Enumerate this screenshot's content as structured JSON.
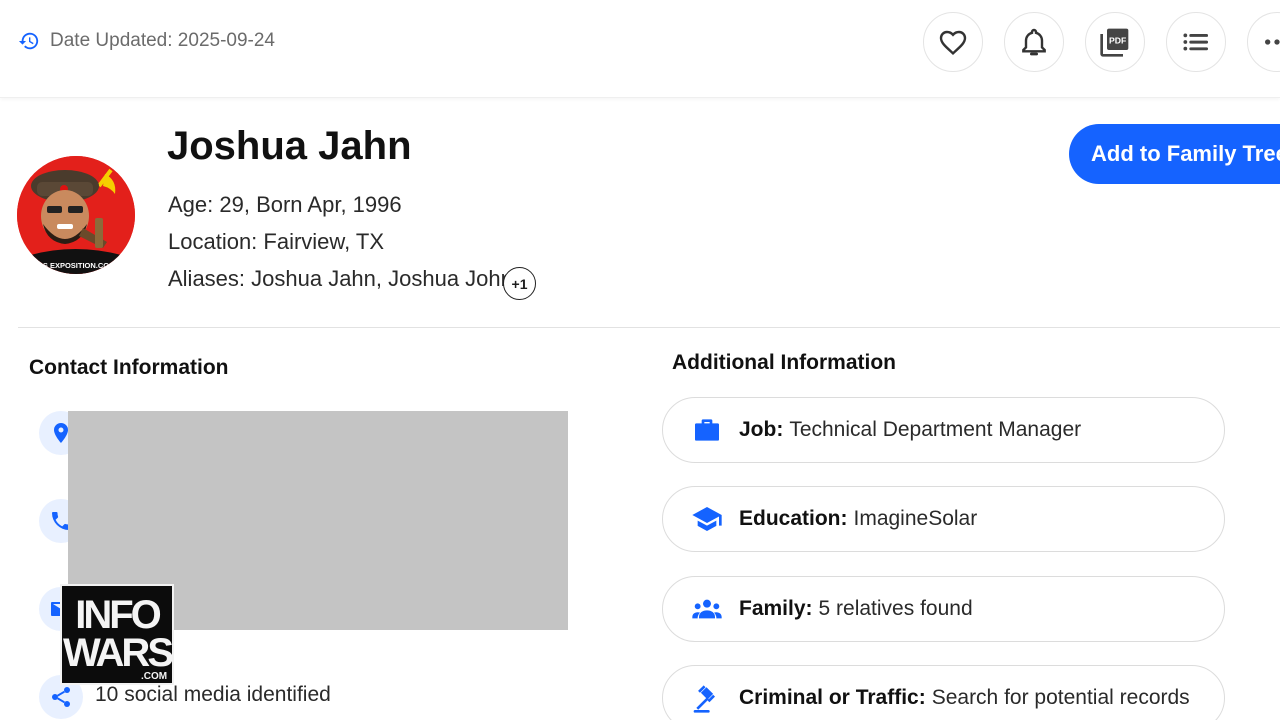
{
  "header": {
    "date_updated": "Date Updated: 2025-09-24",
    "actions": [
      {
        "name": "favorite",
        "icon": "heart-icon"
      },
      {
        "name": "alerts",
        "icon": "bell-icon"
      },
      {
        "name": "pdf",
        "icon": "pdf-icon"
      },
      {
        "name": "list",
        "icon": "list-icon"
      },
      {
        "name": "more",
        "icon": "more-icon"
      }
    ]
  },
  "profile": {
    "name": "Joshua Jahn",
    "age_line": "Age: 29, Born Apr, 1996",
    "location_line": "Location: Fairview, TX",
    "aliases_line": "Aliases: Joshua Jahn, Joshua John",
    "aliases_more": "+1",
    "family_tree_button": "Add to Family Tree",
    "avatar_caption": "…S EXPOSITION.CO…"
  },
  "contact": {
    "title": "Contact Information",
    "icons": [
      "location-pin-icon",
      "phone-icon",
      "email-icon",
      "share-icon"
    ],
    "social_text": "10 social media identified"
  },
  "additional": {
    "title": "Additional Information",
    "items": [
      {
        "icon": "briefcase-icon",
        "label": "Job:",
        "value": "Technical Department Manager"
      },
      {
        "icon": "graduation-cap-icon",
        "label": "Education:",
        "value": "ImagineSolar"
      },
      {
        "icon": "group-icon",
        "label": "Family:",
        "value": "5 relatives found"
      },
      {
        "icon": "gavel-icon",
        "label": "Criminal or Traffic:",
        "value": "Search for potential records"
      }
    ]
  },
  "watermark": {
    "line1": "INFO",
    "line2": "WARS",
    "line3": ".COM"
  },
  "colors": {
    "accent": "#1563ff",
    "icon_bg": "#e8f0ff",
    "redaction": "#c4c4c4"
  }
}
